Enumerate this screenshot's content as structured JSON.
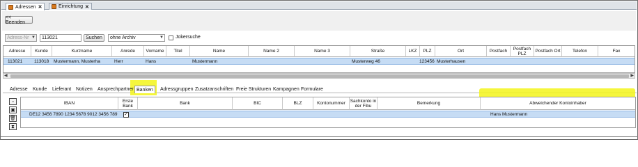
{
  "tabs": [
    {
      "label": "Adressen",
      "active": true
    },
    {
      "label": "Einrichtung",
      "active": false
    }
  ],
  "toolbar": {
    "back_label": "<< Beenden",
    "field_select_value": "Adress-Nr",
    "search_value": "113021",
    "search_label": "Suchen",
    "archive_value": "ohne Archiv",
    "joker_label": "Jokersuche"
  },
  "address_grid": {
    "headers": [
      "Adresse",
      "Kunde",
      "Kurzname",
      "Anrede",
      "Vorname",
      "Titel",
      "Name",
      "Name 2",
      "Name 3",
      "Straße",
      "LKZ",
      "PLZ",
      "Ort",
      "Postfach",
      "Postfach PLZ",
      "Postfach Ort",
      "Telefon",
      "Fax"
    ],
    "row": {
      "adresse": "113021",
      "kunde": "113018",
      "kurzname": "Mustermann, Musterha",
      "anrede": "Herr",
      "vorname": "Hans",
      "name": "Mustermann",
      "strasse": "Musterweg 46",
      "plz": "123456",
      "ort": "Musterhausen"
    }
  },
  "subtabs": [
    "Adresse",
    "Kunde",
    "Lieferant",
    "Notizen",
    "Ansprechpartner",
    "Banken",
    "Adressgruppen",
    "Zusatzanschriften",
    "Freie Strukturen",
    "Kampagnen",
    "Formulare"
  ],
  "bank_grid": {
    "headers": {
      "iban": "IBAN",
      "erste_bank": "Erste Bank",
      "bank": "Bank",
      "bic": "BIC",
      "blz": "BLZ",
      "kontonummer": "Kontonummer",
      "sachkonto": "Sachkonto in der Fibu",
      "bemerkung": "Bemerkung",
      "abw_kontoinhaber": "Abweichender Kontoinhaber"
    },
    "row": {
      "iban": "DE12 3456 7890 1234 5678 9012 3456 789",
      "erste_bank_checked": true,
      "abw_kontoinhaber": "Hans Mustermann"
    }
  },
  "colors": {
    "highlight": "#f3f51a",
    "selection": "#c6dcf4",
    "tab_icon": "#d97a1e"
  }
}
